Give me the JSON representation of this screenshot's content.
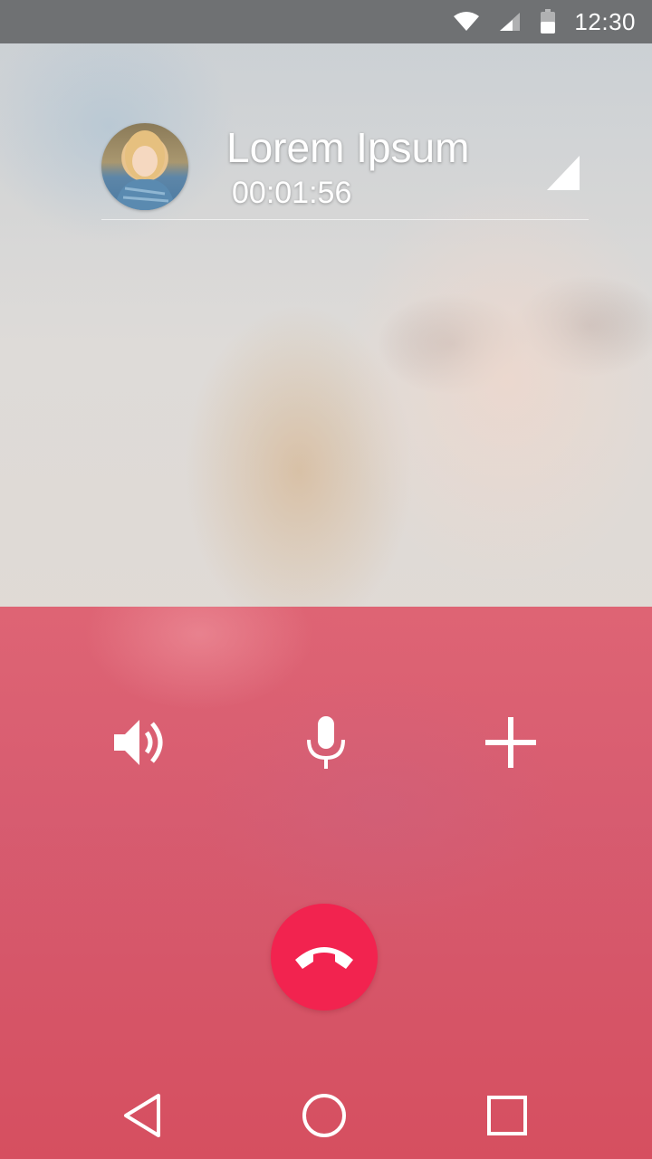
{
  "status_bar": {
    "time": "12:30",
    "icons": [
      "wifi-icon",
      "cell-signal-icon",
      "battery-icon"
    ]
  },
  "caller": {
    "name": "Lorem Ipsum",
    "duration": "00:01:56",
    "avatar": "avatar"
  },
  "controls": {
    "speaker_icon": "speaker-icon",
    "mic_icon": "microphone-icon",
    "add_icon": "add-call-icon",
    "end_call_icon": "end-call-icon",
    "end_call_color": "#f2234f"
  },
  "nav_bar": {
    "icons": [
      "back-icon",
      "home-icon",
      "recent-apps-icon"
    ]
  },
  "colors": {
    "status_bar": "#6f7173",
    "panel": "#d85266",
    "end_call": "#f2234f"
  }
}
